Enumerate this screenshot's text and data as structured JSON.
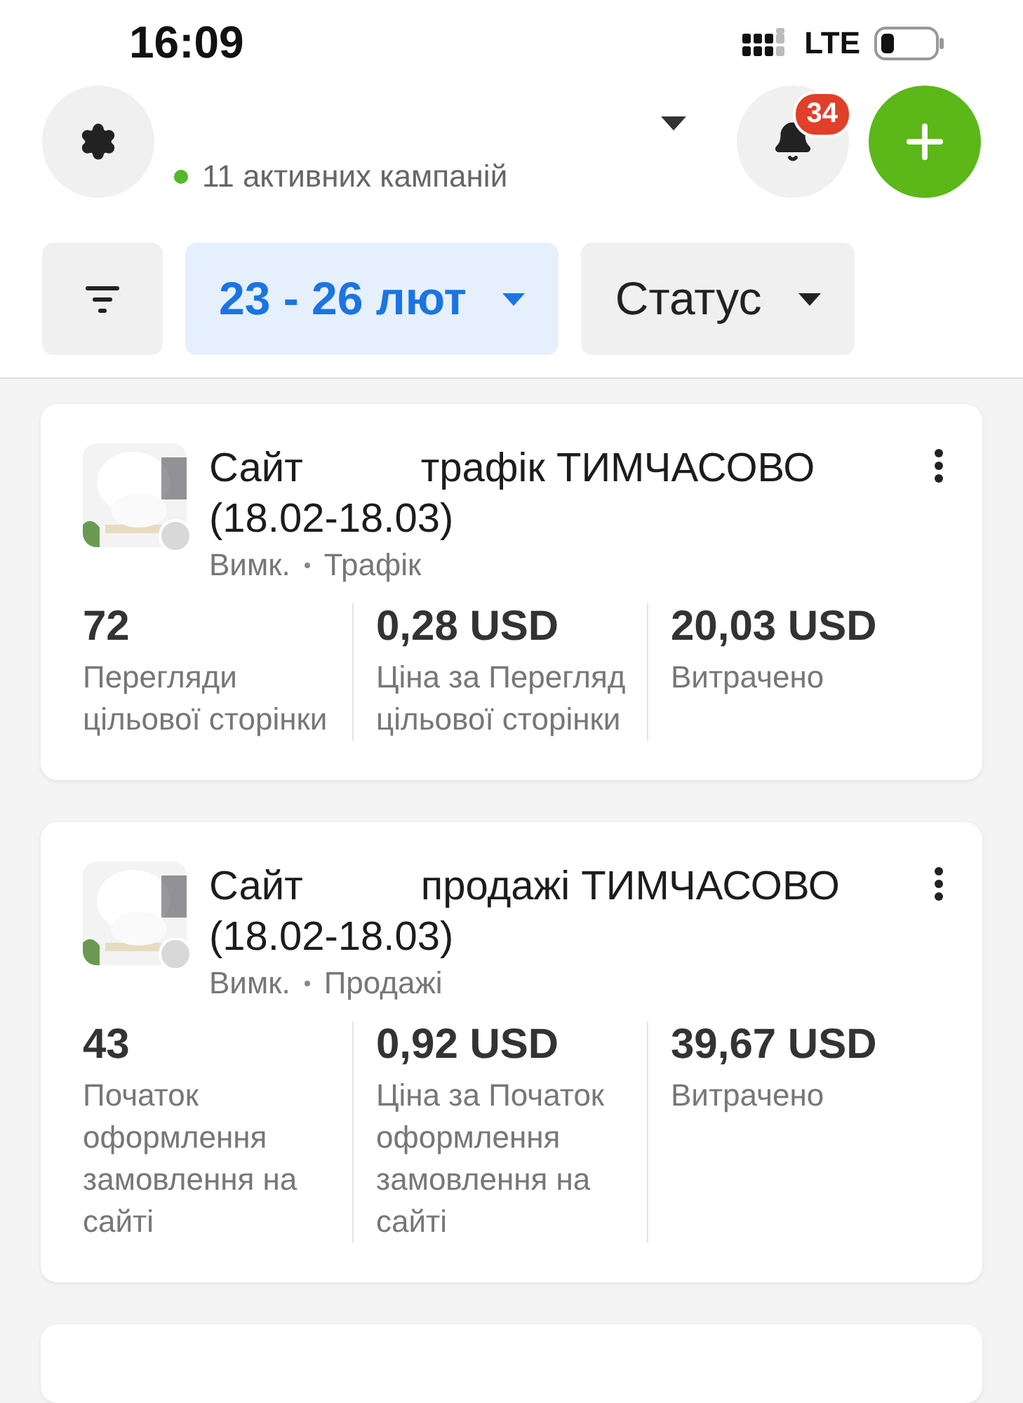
{
  "status_bar": {
    "time": "16:09",
    "network": "LTE"
  },
  "header": {
    "active_campaigns": "11 активних кампаній",
    "notifications": "34"
  },
  "filters": [
    {
      "kind": "icon",
      "selected": false
    },
    {
      "kind": "dropdown",
      "label": "23 - 26 лют",
      "selected": true
    },
    {
      "kind": "dropdown",
      "label": "Статус",
      "selected": false
    }
  ],
  "campaigns": [
    {
      "title_parts": [
        "Сайт",
        "трафік ТИМЧАСОВО (18.02-18.03)"
      ],
      "active": false,
      "status": "Вимк.",
      "objective": "Трафік",
      "metrics": [
        {
          "value": "72",
          "label": "Перегляди цільової сторінки"
        },
        {
          "value": "0,28 USD",
          "label": "Ціна за Перегляд цільової сторінки"
        },
        {
          "value": "20,03 USD",
          "label": "Витрачено"
        }
      ]
    },
    {
      "title_parts": [
        "Сайт",
        "продажі ТИМЧАСОВО (18.02-18.03)"
      ],
      "active": false,
      "status": "Вимк.",
      "objective": "Продажі",
      "metrics": [
        {
          "value": "43",
          "label": "Початок оформлення замовлення на сайті"
        },
        {
          "value": "0,92 USD",
          "label": "Ціна за Початок оформлення замовлення на сайті"
        },
        {
          "value": "39,67 USD",
          "label": "Витрачено"
        }
      ]
    }
  ]
}
